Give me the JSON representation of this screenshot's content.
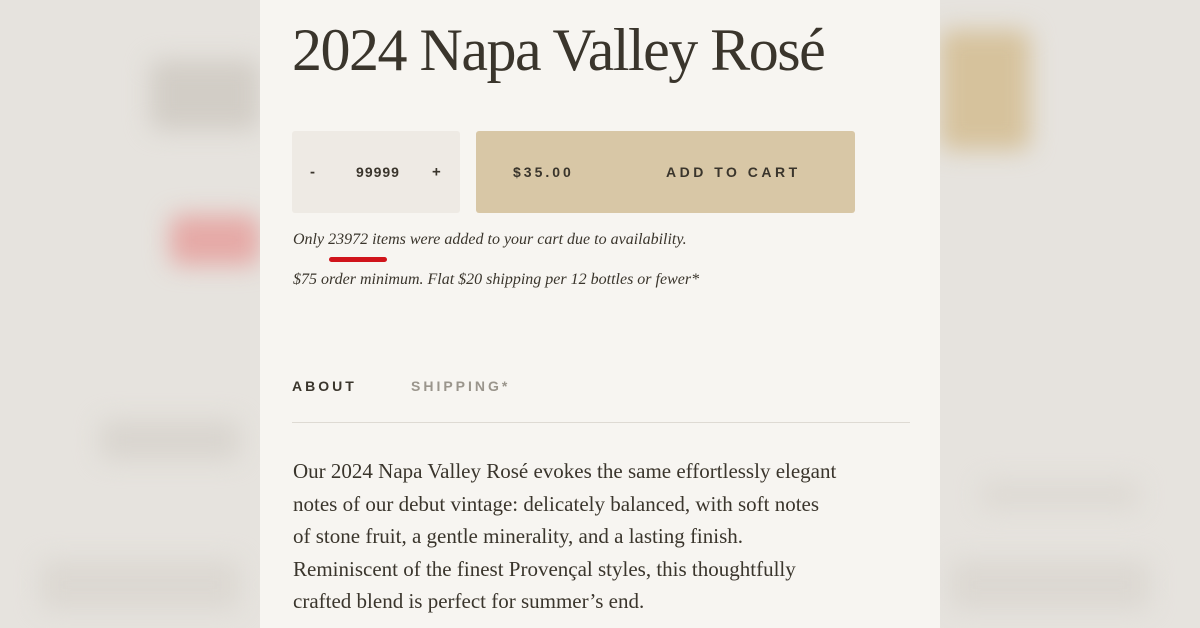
{
  "product": {
    "title": "2024 Napa Valley Rosé"
  },
  "quantity": {
    "minus_label": "-",
    "value": "99999",
    "plus_label": "+"
  },
  "cart_button": {
    "price": "$35.00",
    "label": "ADD TO CART"
  },
  "notices": {
    "availability_prefix": "Only ",
    "availability_count": "23972",
    "availability_suffix": " items were added to your cart due to availability.",
    "shipping_policy": "$75 order minimum. Flat $20 shipping per 12 bottles or fewer*"
  },
  "tabs": [
    {
      "label": "ABOUT",
      "active": true
    },
    {
      "label": "SHIPPING*",
      "active": false
    }
  ],
  "description": {
    "line1": "Our 2024 Napa Valley Rosé evokes the same effortlessly elegant",
    "line2": "notes of our debut vintage: delicately balanced, with soft notes",
    "line3": "of stone fruit, a gentle minerality, and a lasting finish.",
    "line4": "Reminiscent of the finest Provençal styles, this thoughtfully",
    "line5": "crafted blend is perfect for summer’s end."
  },
  "colors": {
    "page_background": "#f7f5f1",
    "text": "#3a352c",
    "cart_button": "#d8c7a6",
    "quantity_box": "#eeeae4",
    "inactive_tab": "#9a958c",
    "highlight_underline": "#d0141b"
  }
}
